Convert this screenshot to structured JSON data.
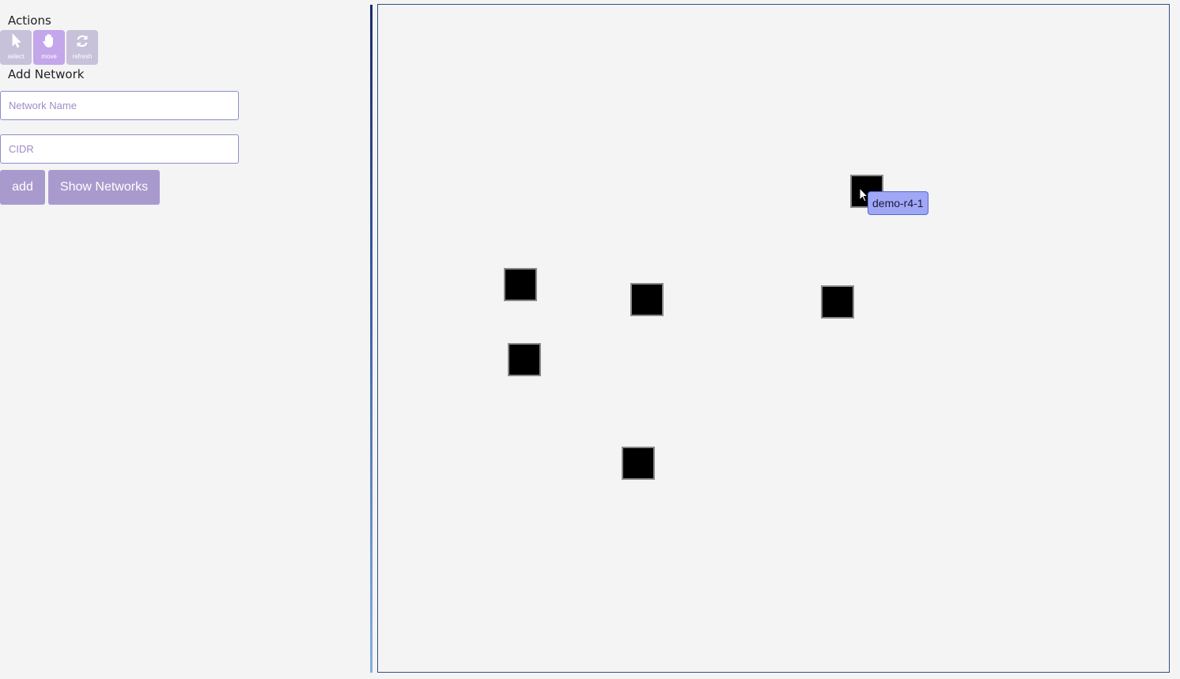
{
  "actions": {
    "title": "Actions",
    "tools": [
      {
        "label": "select",
        "icon": "pointer-icon",
        "active": false
      },
      {
        "label": "move",
        "icon": "hand-icon",
        "active": true
      },
      {
        "label": "refresh",
        "icon": "refresh-icon",
        "active": false
      }
    ]
  },
  "add_network": {
    "title": "Add Network",
    "name_placeholder": "Network Name",
    "cidr_placeholder": "CIDR",
    "add_label": "add",
    "show_label": "Show Networks"
  },
  "canvas": {
    "tooltip": "demo-r4-1"
  },
  "colors": {
    "tool_bg": "#c7c1d9",
    "tool_active_bg": "#c4a6ea",
    "button_bg": "#a99acd",
    "tooltip_bg": "#a0a7f5",
    "node_fill": "#000000"
  }
}
